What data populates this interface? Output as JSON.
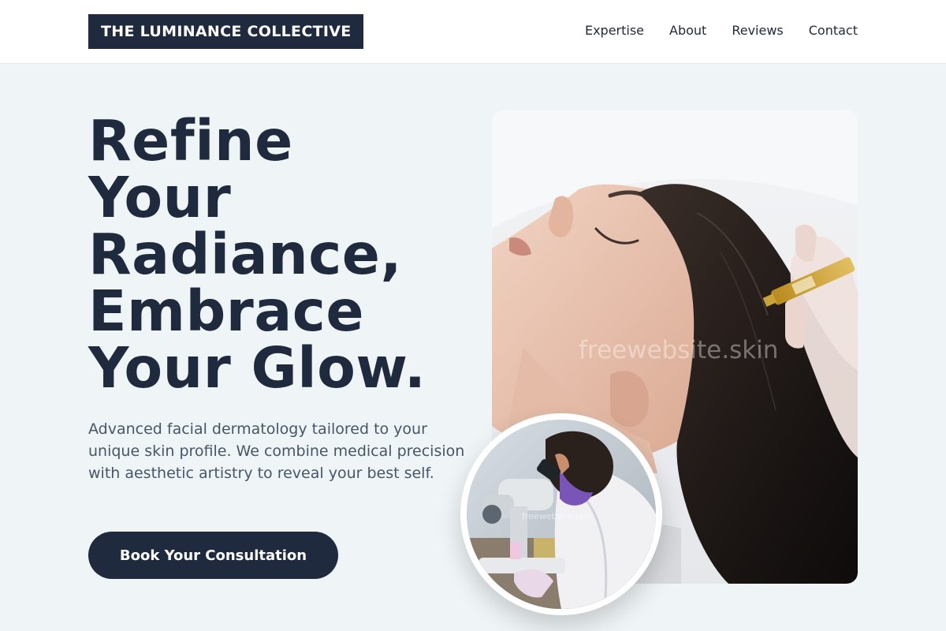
{
  "header": {
    "logo_text": "THE LUMINANCE COLLECTIVE",
    "nav": [
      "Expertise",
      "About",
      "Reviews",
      "Contact"
    ]
  },
  "hero": {
    "headline_lines": [
      "Refine",
      "Your",
      "Radiance,",
      "Embrace",
      "Your Glow."
    ],
    "description": "Advanced facial dermatology tailored to your unique skin profile. We combine medical precision with aesthetic artistry to reveal your best self.",
    "cta_label": "Book Your Consultation"
  },
  "images": {
    "main_watermark": "freewebsite.skin",
    "inset_watermark": "freewebsite.skin"
  },
  "colors": {
    "primary": "#1f2a3e",
    "background": "#eff5f6",
    "body_text": "#475569"
  }
}
